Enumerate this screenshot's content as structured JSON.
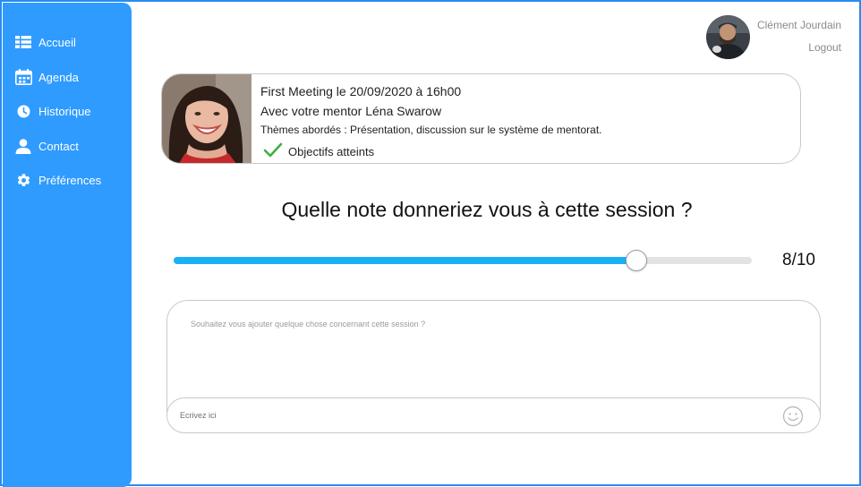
{
  "sidebar": {
    "items": [
      {
        "label": "Accueil",
        "icon": "dashboard-icon"
      },
      {
        "label": "Agenda",
        "icon": "calendar-icon"
      },
      {
        "label": "Historique",
        "icon": "clock-icon"
      },
      {
        "label": "Contact",
        "icon": "person-icon"
      },
      {
        "label": "Préférences",
        "icon": "gear-icon"
      }
    ],
    "color": "#2f9bff"
  },
  "user": {
    "name": "Clément Jourdain",
    "logout_label": "Logout"
  },
  "meeting": {
    "title": "First Meeting le 20/09/2020 à 16h00",
    "mentor": "Avec votre mentor Léna Swarow",
    "themes": "Thèmes abordés : Présentation, discussion sur le système de mentorat.",
    "status": "Objectifs atteints",
    "status_color": "#3cb043"
  },
  "rating": {
    "question": "Quelle note donneriez vous à cette session ?",
    "value": 8,
    "max": 10,
    "display": "8/10",
    "fill_color": "#1ab0f5"
  },
  "comment": {
    "prompt": "Souhaitez vous ajouter quelque chose concernant cette session ?",
    "input_value": "",
    "input_placeholder": "Ecrivez ici"
  }
}
